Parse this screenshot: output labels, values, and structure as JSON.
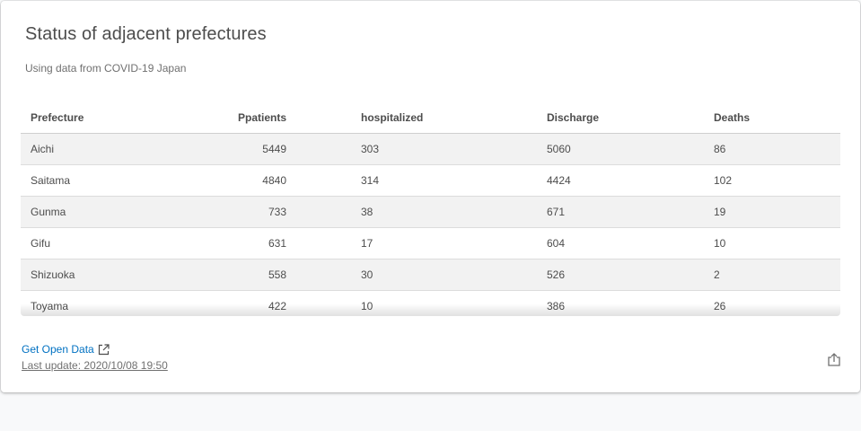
{
  "card": {
    "title": "Status of adjacent prefectures",
    "subtitle": "Using data from COVID-19 Japan"
  },
  "table": {
    "headers": {
      "prefecture": "Prefecture",
      "patients": "Ppatients",
      "hospitalized": "hospitalized",
      "discharge": "Discharge",
      "deaths": "Deaths"
    },
    "rows": [
      {
        "prefecture": "Aichi",
        "patients": "5449",
        "hospitalized": "303",
        "discharge": "5060",
        "deaths": "86"
      },
      {
        "prefecture": "Saitama",
        "patients": "4840",
        "hospitalized": "314",
        "discharge": "4424",
        "deaths": "102"
      },
      {
        "prefecture": "Gunma",
        "patients": "733",
        "hospitalized": "38",
        "discharge": "671",
        "deaths": "19"
      },
      {
        "prefecture": "Gifu",
        "patients": "631",
        "hospitalized": "17",
        "discharge": "604",
        "deaths": "10"
      },
      {
        "prefecture": "Shizuoka",
        "patients": "558",
        "hospitalized": "30",
        "discharge": "526",
        "deaths": "2"
      },
      {
        "prefecture": "Toyama",
        "patients": "422",
        "hospitalized": "10",
        "discharge": "386",
        "deaths": "26"
      }
    ]
  },
  "footer": {
    "open_data_label": "Get Open Data",
    "last_update": "Last update: 2020/10/08 19:50",
    "link_color": "#0071c2",
    "open_data_icon": "external-link-icon",
    "share_icon": "share-icon"
  }
}
